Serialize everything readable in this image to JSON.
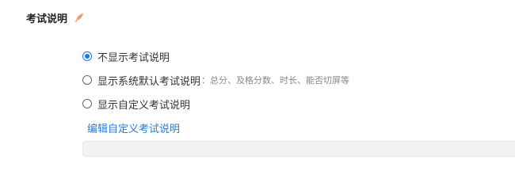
{
  "section": {
    "title": "考试说明",
    "icon": "feather-icon",
    "icon_color": "#f07a2a"
  },
  "options": [
    {
      "label": "不显示考试说明",
      "hint": "",
      "checked": true
    },
    {
      "label": "显示系统默认考试说明",
      "hint": "：总分、及格分数、时长、能否切屏等",
      "checked": false
    },
    {
      "label": "显示自定义考试说明",
      "hint": "",
      "checked": false
    }
  ],
  "edit_link": "编辑自定义考试说明",
  "colors": {
    "accent": "#1a73e8",
    "link": "#2b7bd6",
    "box_bg": "#f2f2f2"
  }
}
